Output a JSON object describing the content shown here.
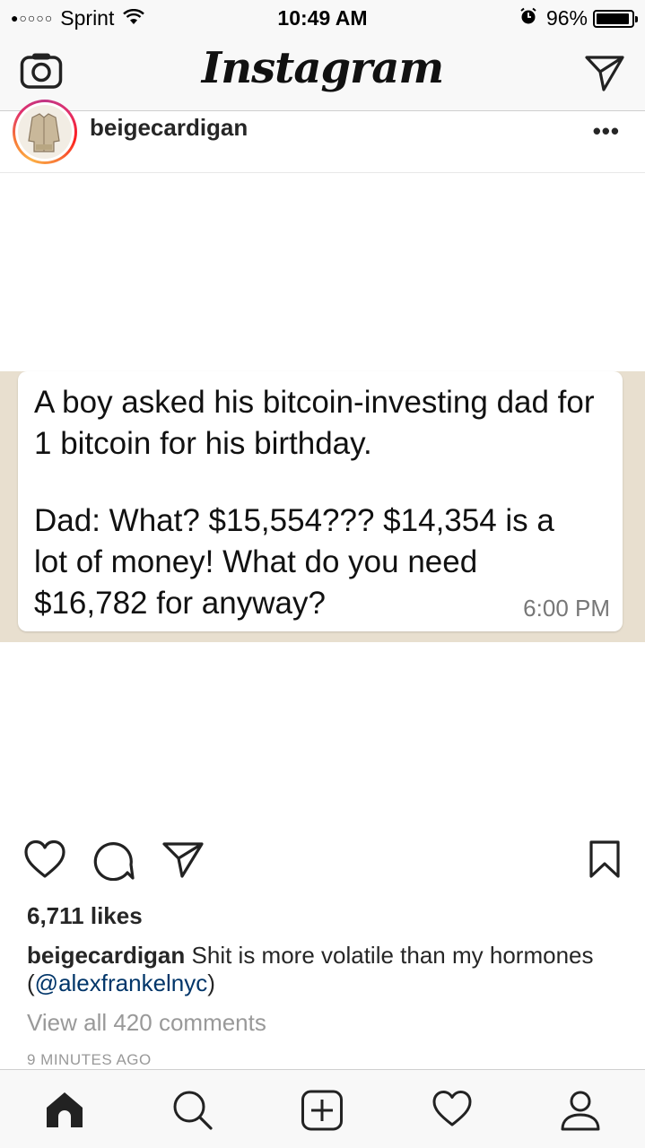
{
  "status_bar": {
    "signal": "●○○○○",
    "carrier": "Sprint",
    "time": "10:49 AM",
    "battery_pct": "96%",
    "battery_level": 0.96
  },
  "header": {
    "logo": "Instagram"
  },
  "post": {
    "username": "beigecardigan",
    "more": "•••",
    "message": {
      "paragraph1": "A boy asked his bitcoin-investing dad for 1 bitcoin for his birthday.",
      "paragraph2": "Dad: What? $15,554??? $14,354 is a lot of money! What do you need $16,782 for anyway?",
      "time": "6:00 PM"
    },
    "likes": "6,711 likes",
    "caption": {
      "username": "beigecardigan",
      "text": "Shit is more volatile than my hormones (",
      "mention": "@alexfrankelnyc",
      "text_end": ")"
    },
    "view_comments": "View all 420 comments",
    "time_ago": "9 MINUTES AGO"
  },
  "icons": [
    "camera-icon",
    "direct-message-icon",
    "heart-icon",
    "comment-icon",
    "share-icon",
    "bookmark-icon",
    "home-icon",
    "search-icon",
    "add-post-icon",
    "activity-icon",
    "profile-icon"
  ]
}
